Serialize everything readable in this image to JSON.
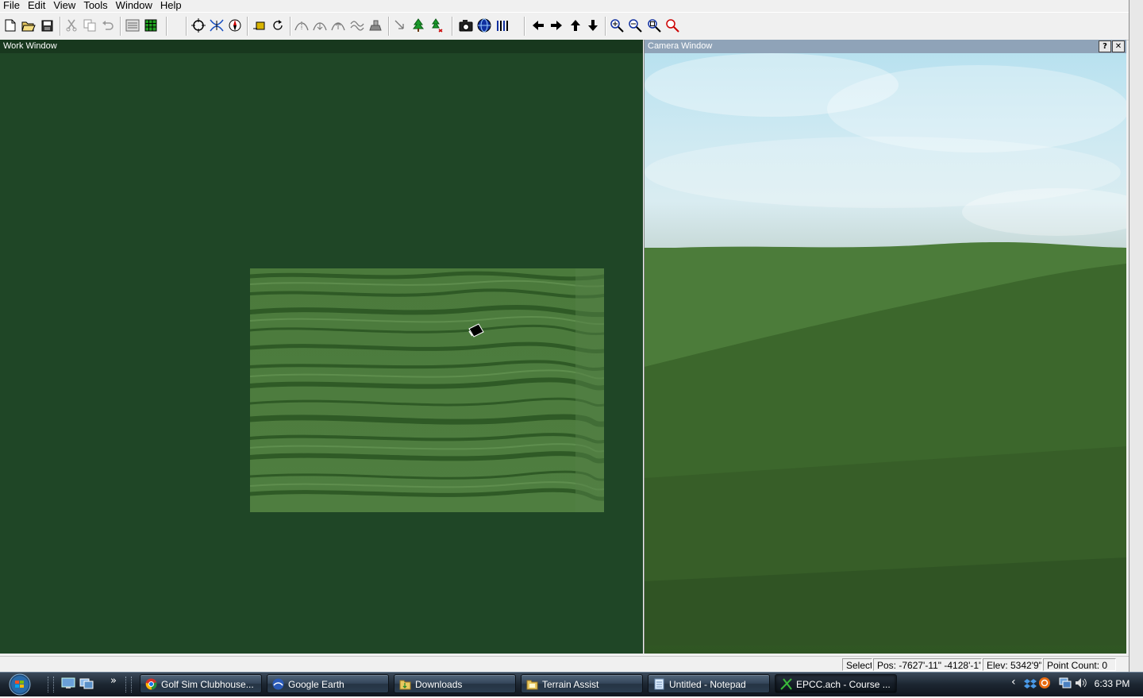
{
  "menu": {
    "items": [
      "File",
      "Edit",
      "View",
      "Tools",
      "Window",
      "Help"
    ]
  },
  "toolbar": {
    "icons": [
      "new-file-icon",
      "open-folder-icon",
      "save-disk-icon",
      "cut-icon",
      "copy-icon",
      "undo-icon",
      "properties-icon",
      "grid-icon",
      "select-circle-icon",
      "curve-tool-icon",
      "compass-icon",
      "layer-icon",
      "rotate-icon",
      "path-icon",
      "arc-icon",
      "arc-up-icon",
      "ridges-icon",
      "grab-icon",
      "pointer-icon",
      "tree-icon",
      "plant-icon",
      "camera-icon",
      "globe-icon",
      "bars-icon",
      "arrow-left-icon",
      "arrow-right-icon",
      "arrow-up-icon",
      "arrow-down-icon",
      "zoom-in-icon",
      "zoom-out-icon",
      "zoom-fit-icon",
      "zoom-red-icon"
    ]
  },
  "work_window": {
    "title": "Work Window"
  },
  "camera_window": {
    "title": "Camera Window",
    "help_label": "?",
    "close_label": "✕"
  },
  "status": {
    "mode": "Select",
    "pos": "Pos: -7627'-11\"  -4128'-1\"",
    "elev": "Elev: 5342'9\"",
    "point_count": "Point Count: 0"
  },
  "taskbar": {
    "tasks": [
      {
        "label": "Golf Sim Clubhouse...",
        "icon": "chrome-icon",
        "active": false
      },
      {
        "label": "Google Earth",
        "icon": "google-earth-icon",
        "active": false
      },
      {
        "label": "Downloads",
        "icon": "folder-icon",
        "active": false
      },
      {
        "label": "Terrain Assist",
        "icon": "folder-icon",
        "active": false
      },
      {
        "label": "Untitled - Notepad",
        "icon": "notepad-icon",
        "active": false
      },
      {
        "label": "EPCC.ach - Course ...",
        "icon": "course-architect-icon",
        "active": true
      }
    ],
    "quick_launch_more": "»",
    "tray_chevron": "‹",
    "clock": "6:33 PM"
  },
  "colors": {
    "work_bg": "#1f4626",
    "sky": "#c6e5f0",
    "grass": "#3b652b",
    "taskbar": "#1c2631"
  }
}
